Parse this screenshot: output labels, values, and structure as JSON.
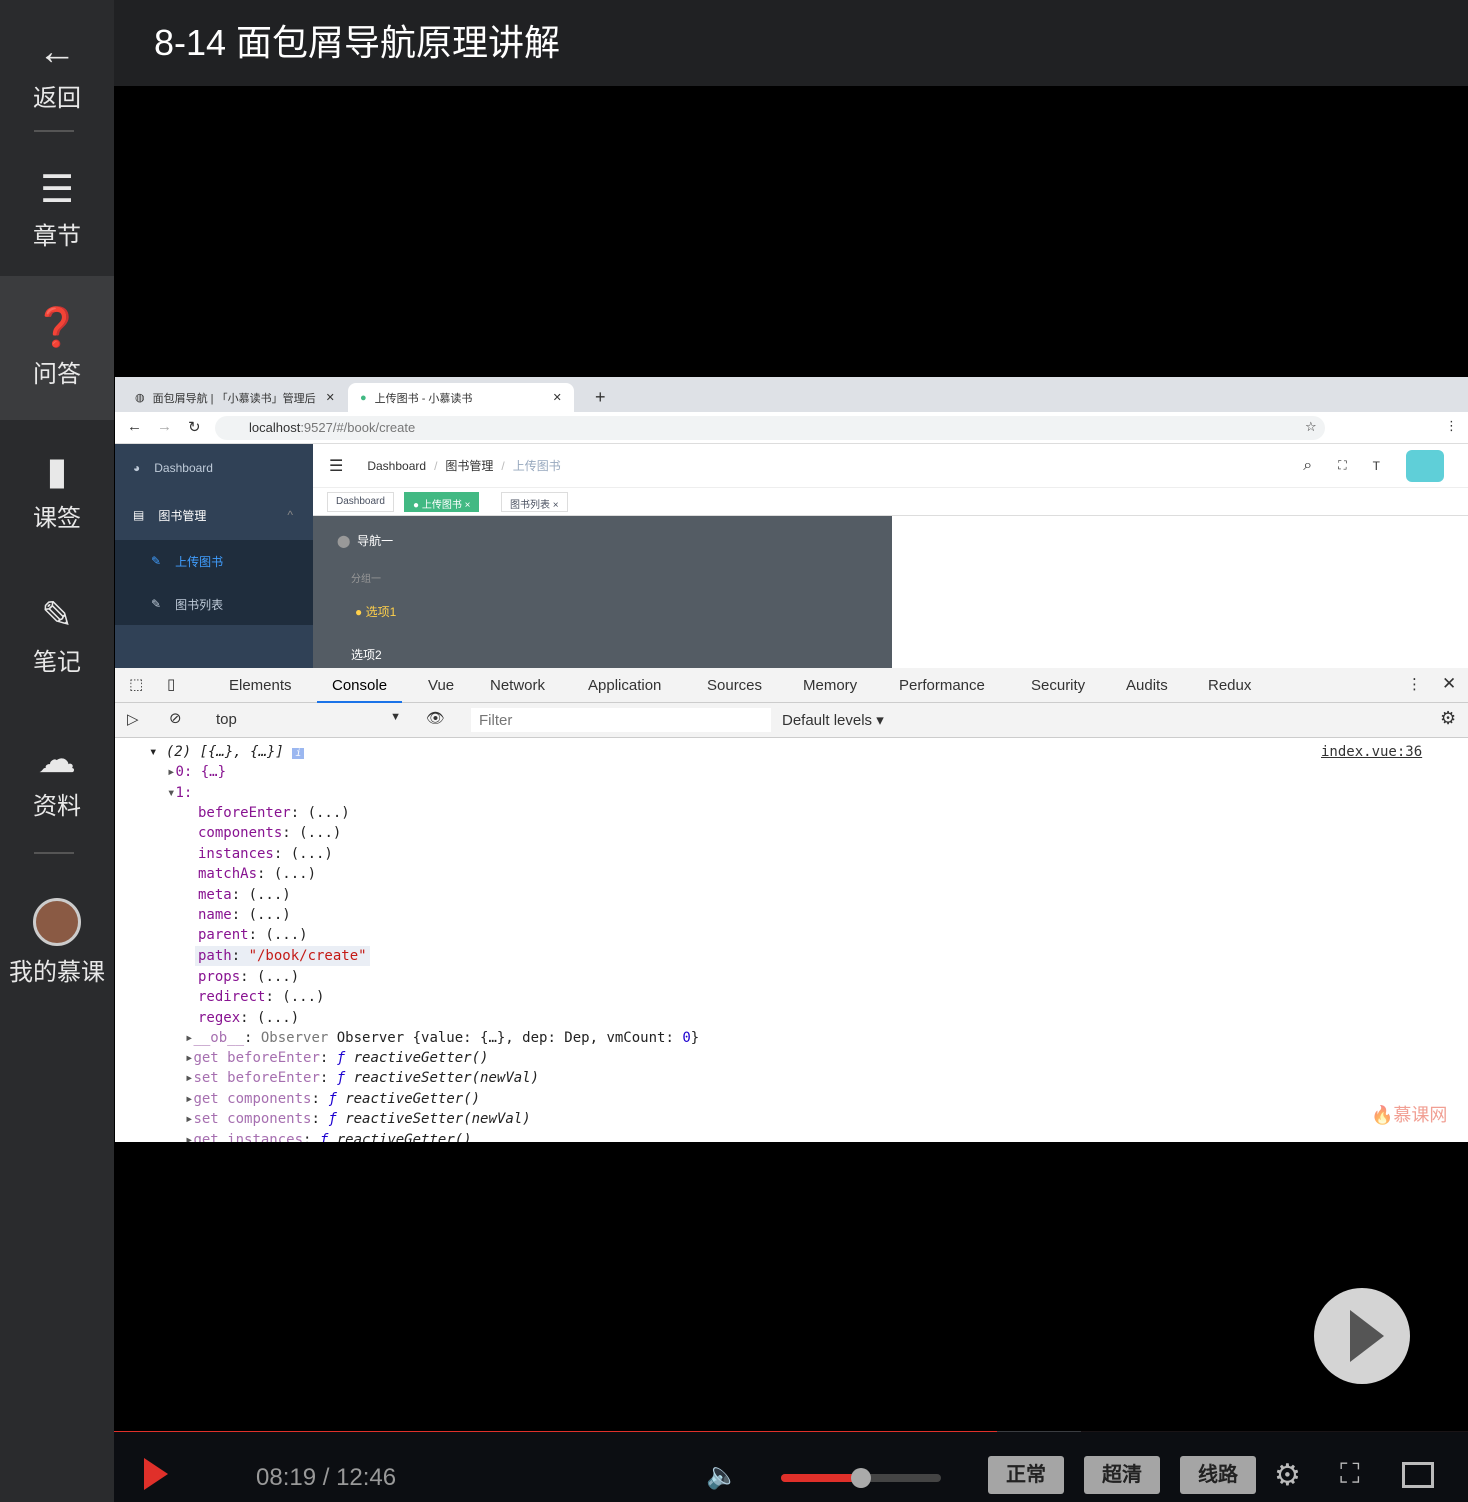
{
  "sidebar": {
    "items": [
      {
        "label": "返回",
        "icon": "arrow-left-icon"
      },
      {
        "label": "章节",
        "icon": "menu-icon"
      },
      {
        "label": "问答",
        "icon": "question-icon"
      },
      {
        "label": "课签",
        "icon": "bookmark-icon"
      },
      {
        "label": "笔记",
        "icon": "pencil-icon"
      },
      {
        "label": "资料",
        "icon": "cloud-download-icon"
      },
      {
        "label": "我的慕课",
        "icon": "avatar"
      }
    ]
  },
  "header": {
    "title": "8-14 面包屑导航原理讲解"
  },
  "browser": {
    "tabs": [
      {
        "label": "面包屑导航 | 「小慕读书」管理后"
      },
      {
        "label": "上传图书 - 小慕读书"
      }
    ],
    "url_host": "localhost",
    "url_rest": ":9527/#/book/create",
    "app": {
      "menu": [
        {
          "label": "Dashboard"
        },
        {
          "label": "图书管理"
        },
        {
          "label": "上传图书"
        },
        {
          "label": "图书列表"
        }
      ],
      "breadcrumb": [
        "Dashboard",
        "图书管理",
        "上传图书"
      ],
      "tags": [
        "Dashboard",
        "上传图书",
        "图书列表"
      ],
      "nav": {
        "title": "导航一",
        "group": "分组一",
        "option1": "选项1",
        "option2": "选项2"
      }
    }
  },
  "devtools": {
    "tabs": [
      "Elements",
      "Console",
      "Vue",
      "Network",
      "Application",
      "Sources",
      "Memory",
      "Performance",
      "Security",
      "Audits",
      "Redux"
    ],
    "active_tab": "Console",
    "context": "top",
    "filter_placeholder": "Filter",
    "levels": "Default levels ▾",
    "source_link": "index.vue:36",
    "log": {
      "summary": "(2) [{…}, {…}]",
      "item0": "0: {…}",
      "item1": "1:",
      "props": [
        "beforeEnter",
        "components",
        "instances",
        "matchAs",
        "meta",
        "name",
        "parent"
      ],
      "path_key": "path",
      "path_value": "\"/book/create\"",
      "props2": [
        "props",
        "redirect",
        "regex"
      ],
      "ob": "__ob__",
      "ob_value": "Observer {value: {…}, dep: Dep, vmCount: ",
      "ob_count": "0",
      "ob_end": "}",
      "accessors": [
        {
          "k": "get beforeEnter",
          "v": "reactiveGetter()"
        },
        {
          "k": "set beforeEnter",
          "v": "reactiveSetter(newVal)"
        },
        {
          "k": "get components",
          "v": "reactiveGetter()"
        },
        {
          "k": "set components",
          "v": "reactiveSetter(newVal)"
        },
        {
          "k": "get instances",
          "v": "reactiveGetter()"
        }
      ]
    }
  },
  "watermark": "慕课网",
  "player": {
    "time": "08:19 / 12:46",
    "progress": 0.652,
    "buffered": 0.714,
    "volume": 0.5,
    "speed": "正常",
    "quality": "超清",
    "route": "线路"
  },
  "colors": {
    "accent": "#e0302a",
    "tag_active": "#42b983",
    "sidebar_bg": "#304156"
  }
}
